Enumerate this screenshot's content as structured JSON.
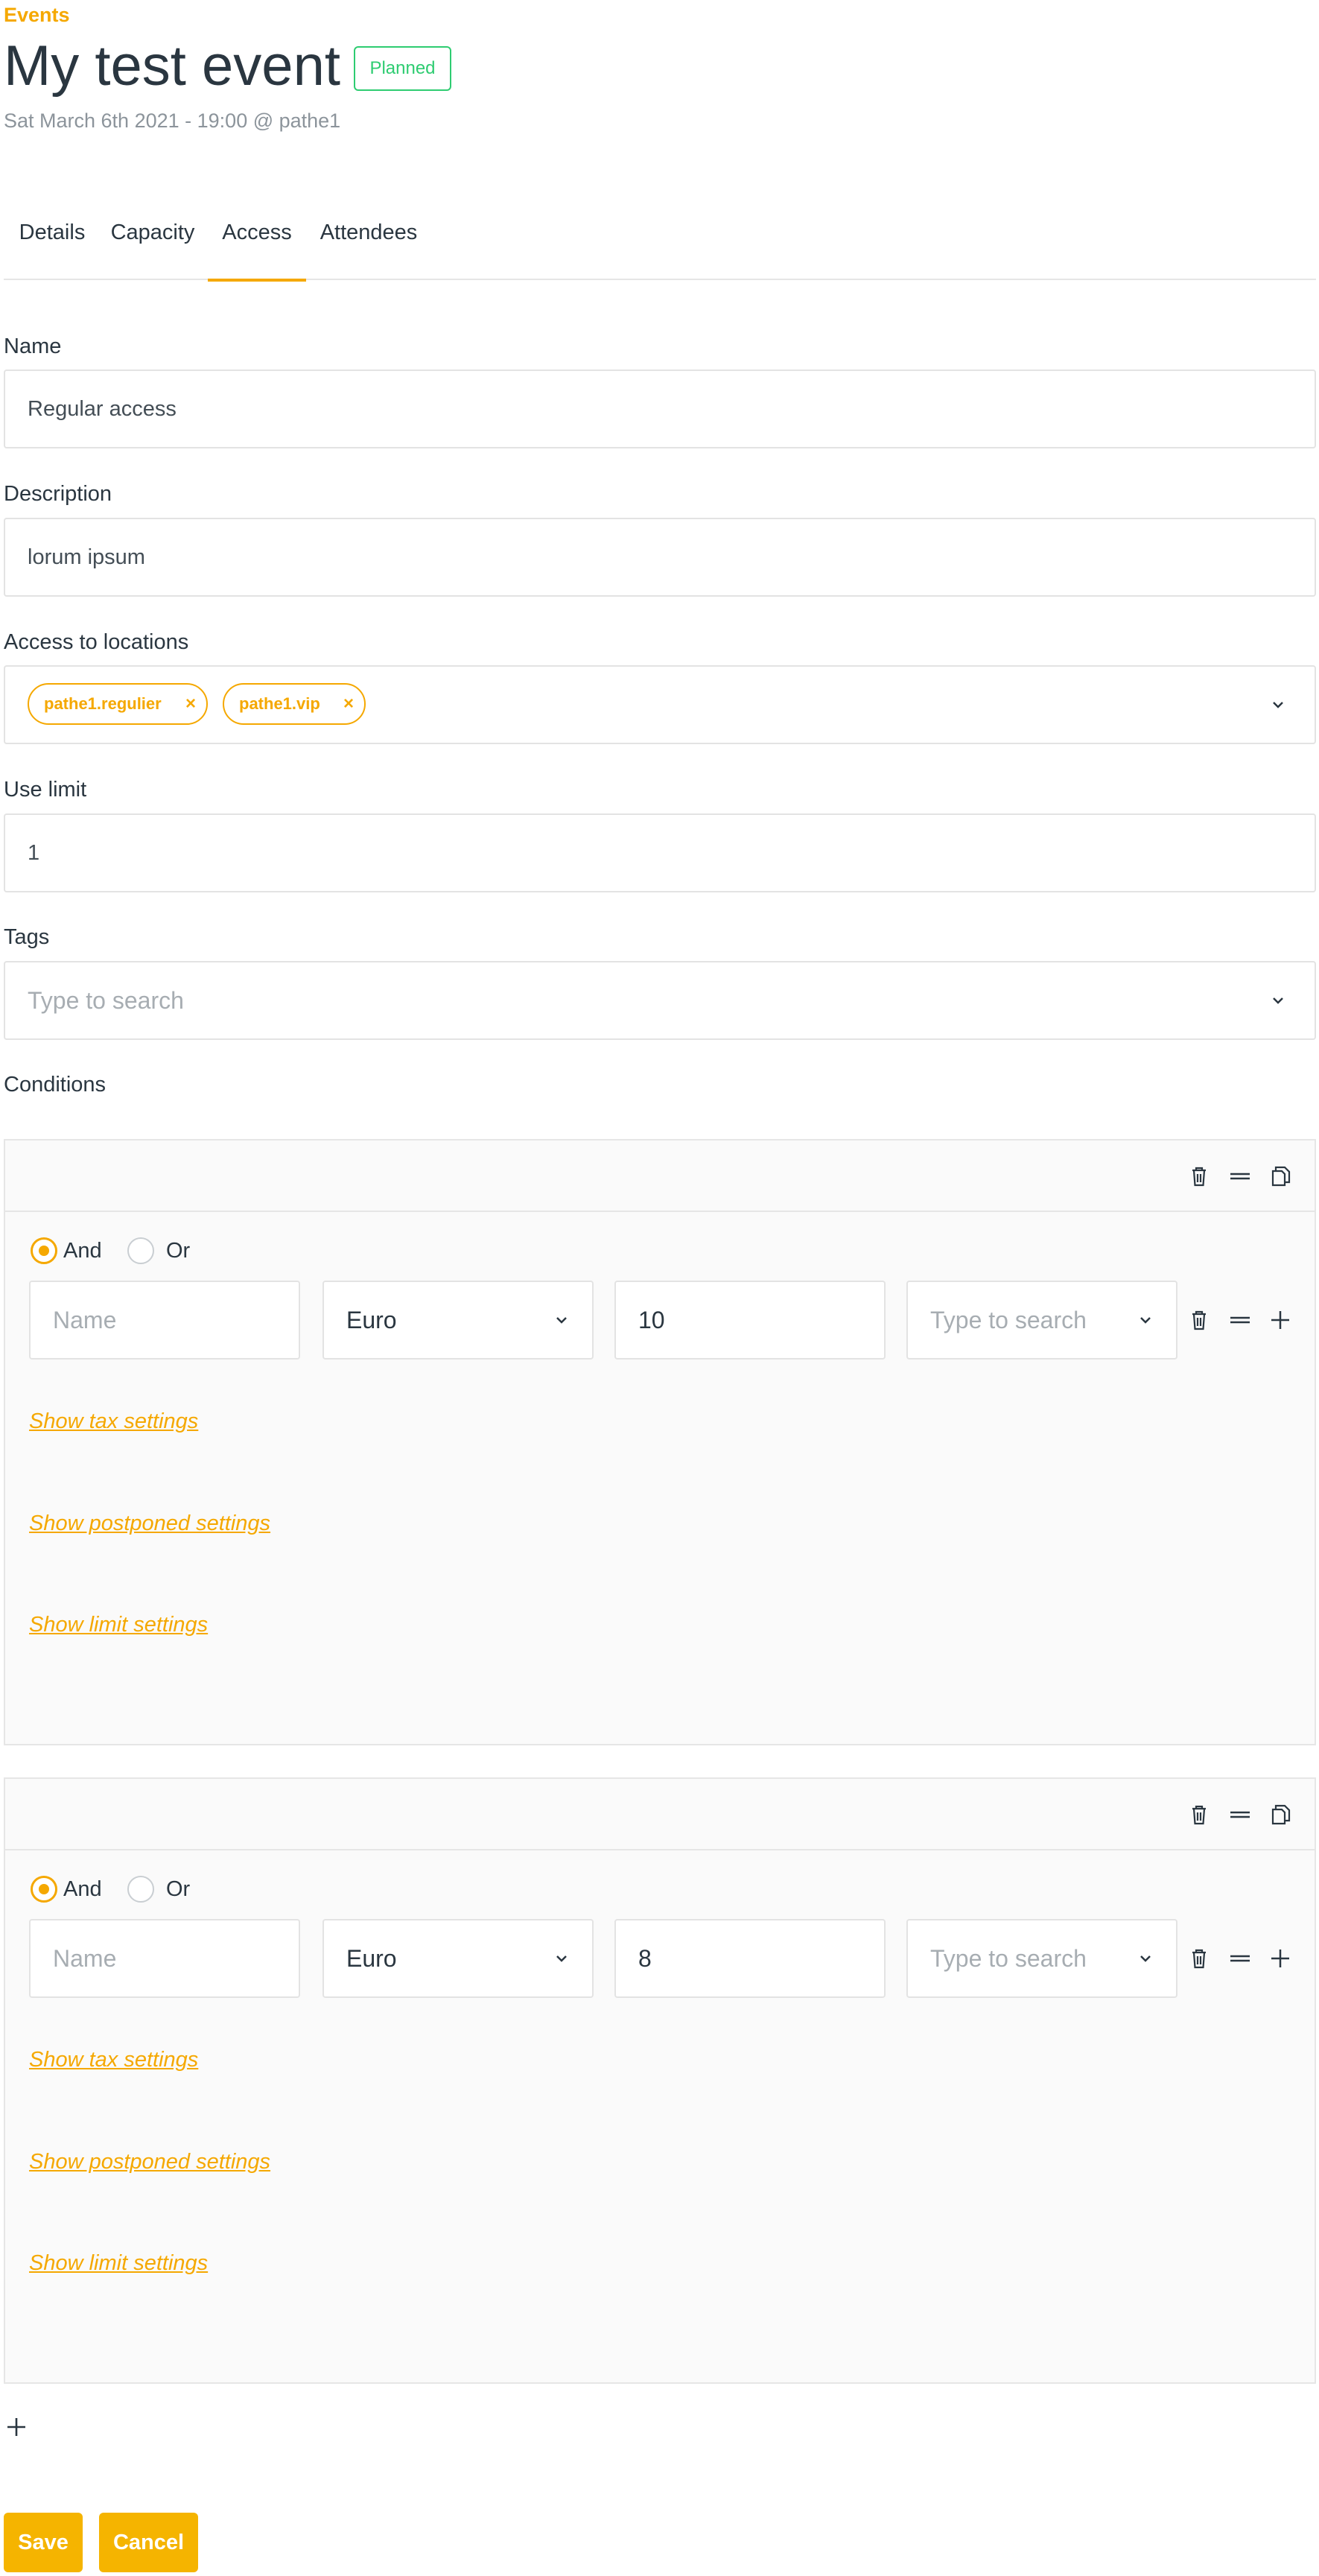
{
  "header": {
    "breadcrumb": "Events",
    "title": "My test event",
    "status_badge": "Planned",
    "subtitle": "Sat March 6th 2021 - 19:00 @ pathe1"
  },
  "tabs": [
    {
      "label": "Details",
      "active": false
    },
    {
      "label": "Capacity",
      "active": false
    },
    {
      "label": "Access",
      "active": true
    },
    {
      "label": "Attendees",
      "active": false
    }
  ],
  "form": {
    "name_label": "Name",
    "name_value": "Regular access",
    "description_label": "Description",
    "description_value": "lorum ipsum",
    "locations_label": "Access to locations",
    "locations": [
      "pathe1.regulier",
      "pathe1.vip"
    ],
    "use_limit_label": "Use limit",
    "use_limit_value": "1",
    "tags_label": "Tags",
    "tags_placeholder": "Type to search",
    "conditions_label": "Conditions"
  },
  "conditions": [
    {
      "and_label": "And",
      "or_label": "Or",
      "selected": "And",
      "name_placeholder": "Name",
      "currency": "Euro",
      "amount": "10",
      "search_placeholder": "Type to search",
      "tax_link": "Show tax settings",
      "postponed_link": "Show postponed settings",
      "limit_link": "Show limit settings"
    },
    {
      "and_label": "And",
      "or_label": "Or",
      "selected": "And",
      "name_placeholder": "Name",
      "currency": "Euro",
      "amount": "8",
      "search_placeholder": "Type to search",
      "tax_link": "Show tax settings",
      "postponed_link": "Show postponed settings",
      "limit_link": "Show limit settings"
    }
  ],
  "actions": {
    "save_label": "Save",
    "cancel_label": "Cancel"
  },
  "colors": {
    "accent": "#f5a800",
    "status_planned": "#2ecc71",
    "text": "#2a3640",
    "muted": "#8c949b"
  }
}
